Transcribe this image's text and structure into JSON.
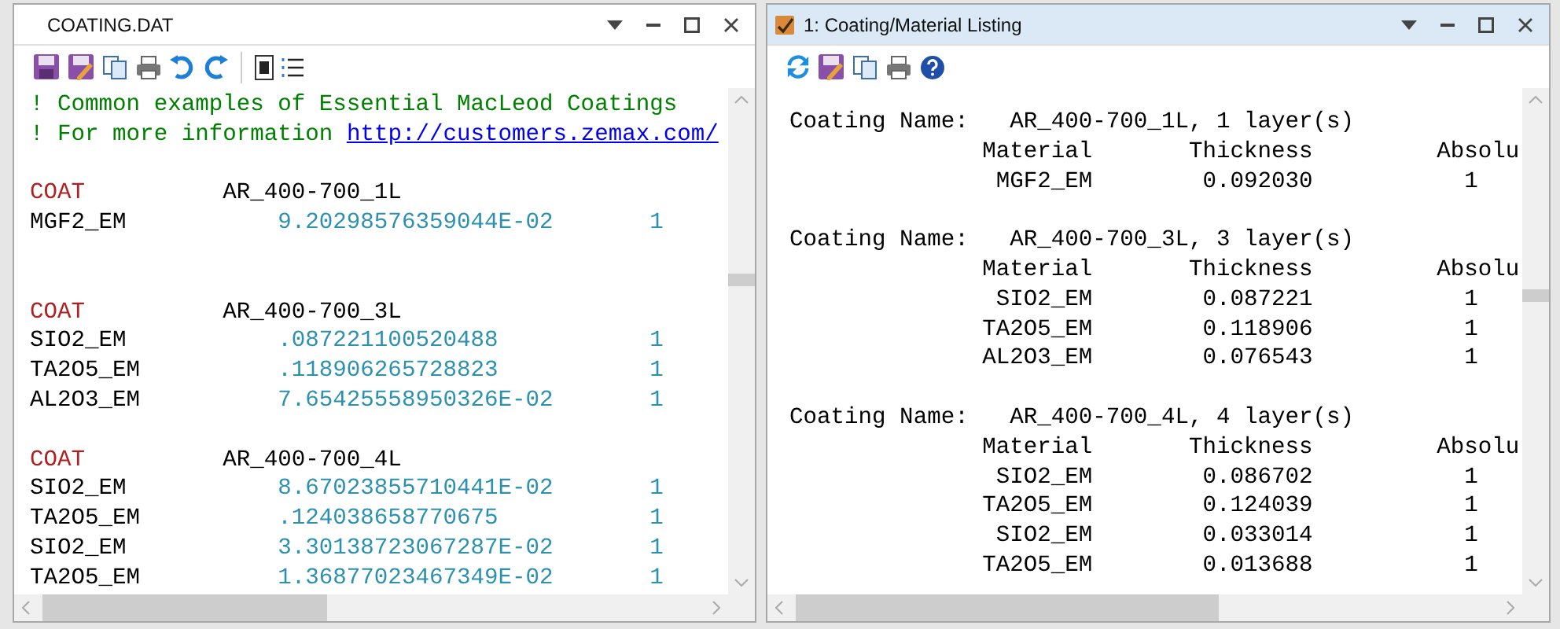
{
  "left_window": {
    "title": "COATING.DAT",
    "active": false,
    "comments": [
      {
        "text": "! Common examples of Essential MacLeod Coatings"
      },
      {
        "text": "! For more information ",
        "link": "http://customers.zemax.com/"
      }
    ],
    "coatings": [
      {
        "keyword": "COAT",
        "name": "AR_400-700_1L",
        "layers": [
          {
            "material": "MGF2_EM",
            "thickness": "9.20298576359044E-02",
            "value": "1"
          }
        ]
      },
      {
        "keyword": "COAT",
        "name": "AR_400-700_3L",
        "layers": [
          {
            "material": "SIO2_EM",
            "thickness": ".087221100520488",
            "value": "1"
          },
          {
            "material": "TA2O5_EM",
            "thickness": ".118906265728823",
            "value": "1"
          },
          {
            "material": "AL2O3_EM",
            "thickness": "7.65425558950326E-02",
            "value": "1"
          }
        ]
      },
      {
        "keyword": "COAT",
        "name": "AR_400-700_4L",
        "layers": [
          {
            "material": "SIO2_EM",
            "thickness": "8.67023855710441E-02",
            "value": "1"
          },
          {
            "material": "TA2O5_EM",
            "thickness": ".124038658770675",
            "value": "1"
          },
          {
            "material": "SIO2_EM",
            "thickness": "3.30138723067287E-02",
            "value": "1"
          },
          {
            "material": "TA2O5_EM",
            "thickness": "1.36877023467349E-02",
            "value": "1"
          }
        ]
      }
    ]
  },
  "right_window": {
    "title": "1: Coating/Material Listing",
    "active": true,
    "blocks": [
      {
        "label": "Coating Name:",
        "name": "AR_400-700_1L, 1 layer(s)",
        "columns": [
          "Material",
          "Thickness",
          "Absolu"
        ],
        "rows": [
          {
            "material": "MGF2_EM",
            "thickness": "0.092030",
            "value": "1"
          }
        ]
      },
      {
        "label": "Coating Name:",
        "name": "AR_400-700_3L, 3 layer(s)",
        "columns": [
          "Material",
          "Thickness",
          "Absolu"
        ],
        "rows": [
          {
            "material": "SIO2_EM",
            "thickness": "0.087221",
            "value": "1"
          },
          {
            "material": "TA2O5_EM",
            "thickness": "0.118906",
            "value": "1"
          },
          {
            "material": "AL2O3_EM",
            "thickness": "0.076543",
            "value": "1"
          }
        ]
      },
      {
        "label": "Coating Name:",
        "name": "AR_400-700_4L, 4 layer(s)",
        "columns": [
          "Material",
          "Thickness",
          "Absolu"
        ],
        "rows": [
          {
            "material": "SIO2_EM",
            "thickness": "0.086702",
            "value": "1"
          },
          {
            "material": "TA2O5_EM",
            "thickness": "0.124039",
            "value": "1"
          },
          {
            "material": "SIO2_EM",
            "thickness": "0.033014",
            "value": "1"
          },
          {
            "material": "TA2O5_EM",
            "thickness": "0.013688",
            "value": "1"
          }
        ]
      }
    ]
  }
}
